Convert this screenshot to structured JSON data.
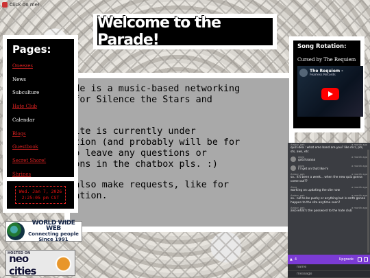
{
  "topbar": {
    "clickme": "Click on me!"
  },
  "header": {
    "title": "Welcome to the Parade!"
  },
  "nav": {
    "heading": "Pages:",
    "items": [
      {
        "label": "Oneezes",
        "link": true
      },
      {
        "label": "News",
        "link": false
      },
      {
        "label": "Subculture",
        "link": false
      },
      {
        "label": "Hate Club",
        "link": true
      },
      {
        "label": "Calendar",
        "link": false
      },
      {
        "label": "Blogs",
        "link": true
      },
      {
        "label": "Guestbook",
        "link": true
      },
      {
        "label": "Secret Shore!",
        "link": true
      },
      {
        "label": "Shrines",
        "link": true
      }
    ]
  },
  "clock": {
    "line1": "Wed. Jan 7, 2026",
    "line2": "2:25:05 pm CST"
  },
  "main": {
    "paragraphs": [
      " Parade is a music-based networking\nsite for Silence the Stars and\nends!",
      " website is currently under\nstruction (and probably will be for\nle) so leave any questions or\ngestions in the chatbox pls. :)",
      " can also make requests, like for\ng rotation."
    ]
  },
  "rotation": {
    "heading": "Song Rotation:",
    "song": "Cursed by The Requiem",
    "video_title": "The Requiem -",
    "video_channel": "Fearless Records"
  },
  "badges": {
    "www_l1": "WORLD WIDE WEB",
    "www_l2": "Connecting people",
    "www_l3": "Since 1991",
    "neo_hosted": "HOSTED ON",
    "neo_name": "neo cities"
  },
  "chat": {
    "messages": [
      {
        "name": "Ambar_gah",
        "time": "a month ago",
        "text": "quiz idea : what emo band are you? like mcr, pts, sts, aws, etc",
        "avatar": false
      },
      {
        "name": "Alora",
        "time": "a month ago",
        "text": "gotchaaaaa",
        "avatar": true
      },
      {
        "name": "Alora",
        "time": "a month ago",
        "text": "I'll get on that like hi",
        "avatar": true
      },
      {
        "name": "Ambar_gah",
        "time": "a month ago",
        "text": "so.. it's been a week... when the new quiz gonna come out??",
        "avatar": false
      },
      {
        "name": "Alora",
        "time": "a month ago",
        "text": "working on updating the site now",
        "avatar": false
      },
      {
        "name": "Ambar_gah",
        "time": "a month ago",
        "text": "so.. not to be pushy or anything but is smth gonna happen to the site anytime soon?",
        "avatar": false
      },
      {
        "name": "Ambar_gah",
        "time": "a month ago",
        "text": "also what's the password to the hate club",
        "avatar": false
      }
    ],
    "online_count": "4",
    "upgrade_label": "Upgrade",
    "name_placeholder": "name",
    "message_placeholder": "message"
  }
}
